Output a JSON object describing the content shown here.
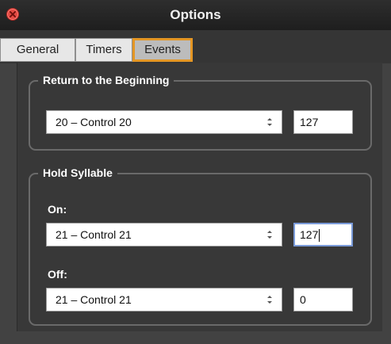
{
  "window": {
    "title": "Options"
  },
  "tabs": [
    {
      "label": "General",
      "selected": false
    },
    {
      "label": "Timers",
      "selected": false
    },
    {
      "label": "Events",
      "selected": true
    }
  ],
  "return_group": {
    "title": "Return to the Beginning",
    "select_value": "20 – Control 20",
    "field_value": "127"
  },
  "hold_group": {
    "title": "Hold Syllable",
    "on_label": "On:",
    "on_select_value": "21 – Control 21",
    "on_field_value": "127",
    "off_label": "Off:",
    "off_select_value": "21 – Control 21",
    "off_field_value": "0"
  },
  "colors": {
    "accent_tab_border": "#e49624",
    "close_button": "#e24a43",
    "focus_ring": "#7a9ad8"
  }
}
